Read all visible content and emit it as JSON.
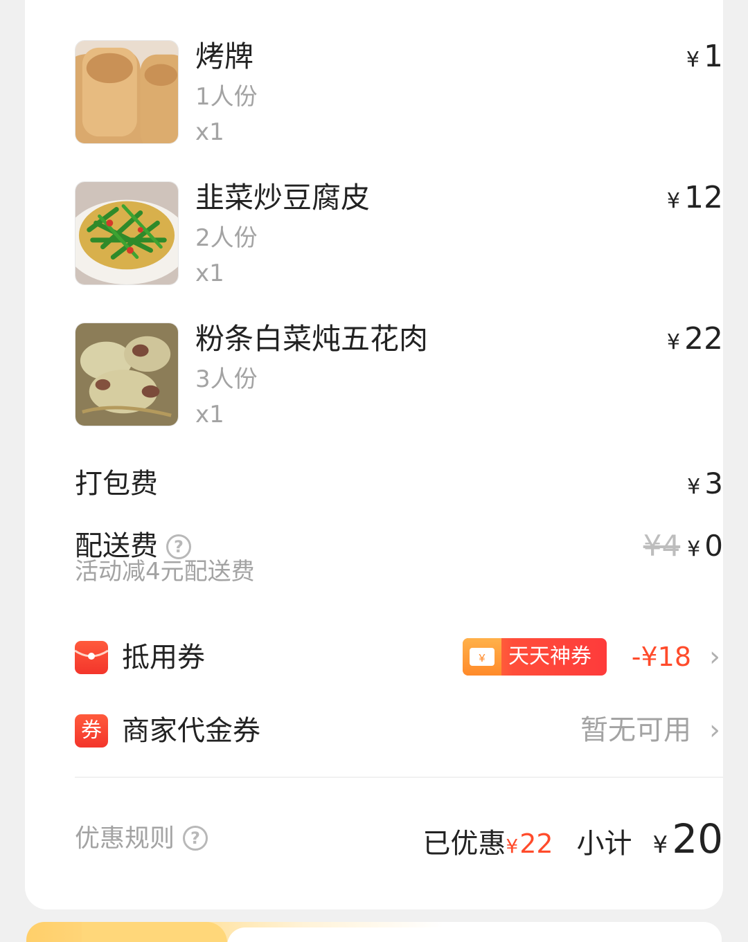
{
  "order_items": [
    {
      "name": "烤牌",
      "portion": "1人份",
      "qty": "x1",
      "price": "1"
    },
    {
      "name": "韭菜炒豆腐皮",
      "portion": "2人份",
      "qty": "x1",
      "price": "12"
    },
    {
      "name": "粉条白菜炖五花肉",
      "portion": "3人份",
      "qty": "x1",
      "price": "22"
    }
  ],
  "currency": "¥",
  "packing_fee": {
    "label": "打包费",
    "price": "3"
  },
  "delivery_fee": {
    "label": "配送费",
    "original": "¥4",
    "price": "0",
    "note": "活动减4元配送费"
  },
  "coupon": {
    "label": "抵用券",
    "badge": "天天神券",
    "amount": "-¥18"
  },
  "merchant_voucher": {
    "label": "商家代金券",
    "icon_char": "券",
    "status": "暂无可用"
  },
  "footer": {
    "rules": "优惠规则",
    "saved_label": "已优惠",
    "saved_amount": "22",
    "subtotal_label": "小计",
    "subtotal_amount": "20"
  },
  "colors": {
    "accent_red": "#ff4b2b",
    "muted_text": "#a3a3a3"
  },
  "icons": [
    "help-icon",
    "red-envelope-icon",
    "voucher-icon",
    "chevron-right-icon",
    "ticket-icon"
  ]
}
